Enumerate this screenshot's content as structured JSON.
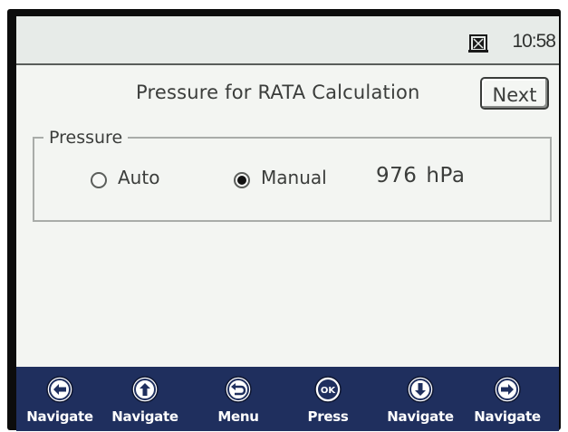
{
  "status_bar": {
    "clock": "10:58",
    "status_icon": "status-icon"
  },
  "main": {
    "title": "Pressure for RATA Calculation",
    "next_label": "Next",
    "pressure_group": {
      "legend": "Pressure",
      "options": [
        {
          "label": "Auto",
          "selected": false
        },
        {
          "label": "Manual",
          "selected": true
        }
      ],
      "value": "976",
      "unit": "hPa"
    }
  },
  "nav_bar": {
    "buttons": [
      {
        "label": "Navigate",
        "icon": "arrow-left-circle-icon"
      },
      {
        "label": "Navigate",
        "icon": "arrow-up-circle-icon"
      },
      {
        "label": "Menu",
        "icon": "back-circle-icon"
      },
      {
        "label": "Press",
        "icon": "ok-circle-icon"
      },
      {
        "label": "Navigate",
        "icon": "arrow-down-circle-icon"
      },
      {
        "label": "Navigate",
        "icon": "arrow-right-circle-icon"
      }
    ],
    "background": "#1f2f5e"
  }
}
